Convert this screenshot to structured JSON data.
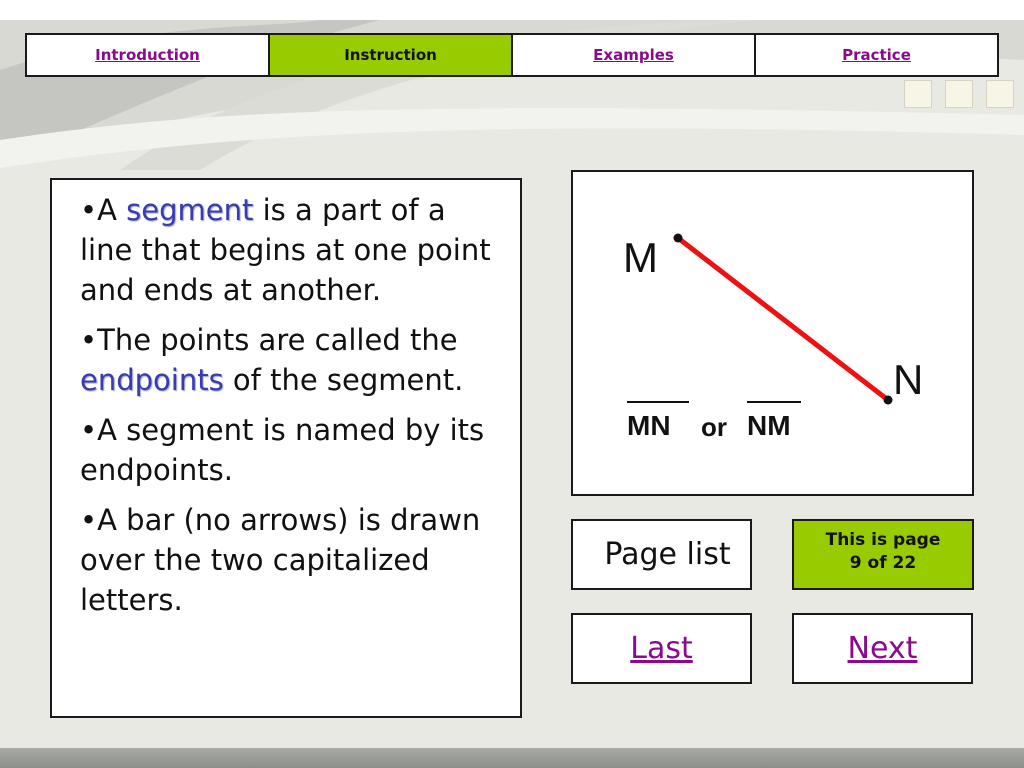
{
  "nav": {
    "tabs": [
      {
        "label": "Introduction",
        "active": false
      },
      {
        "label": "Instruction",
        "active": true
      },
      {
        "label": "Examples",
        "active": false
      },
      {
        "label": "Practice",
        "active": false
      }
    ]
  },
  "content": {
    "bullets": [
      {
        "pre": "•A ",
        "term": "segment",
        "post": " is a part of a line that begins at one point and ends at another."
      },
      {
        "pre": "•The points are called the ",
        "term": "endpoints",
        "post": " of the segment."
      },
      {
        "pre": "•A segment is named by its endpoints.",
        "term": "",
        "post": ""
      },
      {
        "pre": "•A bar (no arrows) is drawn over the two capitalized letters.",
        "term": "",
        "post": ""
      }
    ]
  },
  "diagram": {
    "point_m": "M",
    "point_n": "N",
    "name_1": "MN",
    "connector": "or",
    "name_2": "NM",
    "segment_color": "#ee1111"
  },
  "footer": {
    "page_list_label": "Page list",
    "page_info_line1": "This is page",
    "page_info_line2": "9 of 22",
    "last_label": "Last",
    "next_label": "Next"
  },
  "colors": {
    "accent_green": "#99cc00",
    "link_purple": "#8b0a8b",
    "term_blue": "#3b3bb0"
  }
}
